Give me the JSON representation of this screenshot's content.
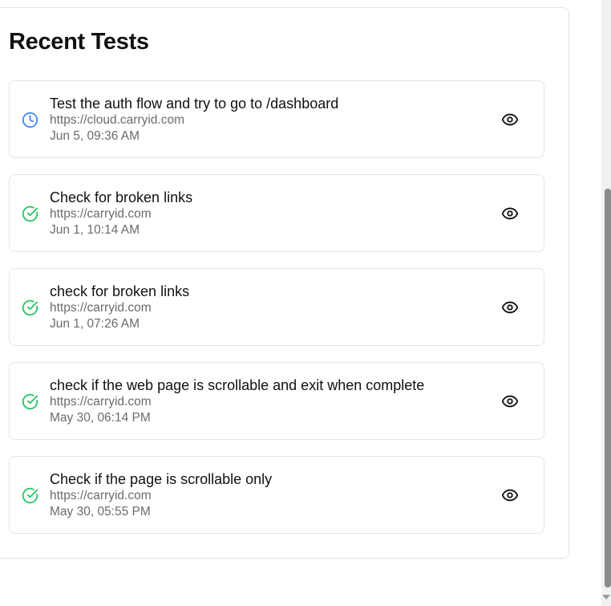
{
  "title": "Recent Tests",
  "colors": {
    "pending": "#3b82f6",
    "success": "#22c55e"
  },
  "tests": [
    {
      "name": "Test the auth flow and try to go to /dashboard",
      "url": "https://cloud.carryid.com",
      "date": "Jun 5, 09:36 AM",
      "status": "pending",
      "status_icon": "clock-icon",
      "action_icon": "eye-icon"
    },
    {
      "name": "Check for broken links",
      "url": "https://carryid.com",
      "date": "Jun 1, 10:14 AM",
      "status": "success",
      "status_icon": "check-circle-icon",
      "action_icon": "eye-icon"
    },
    {
      "name": "check for broken links",
      "url": "https://carryid.com",
      "date": "Jun 1, 07:26 AM",
      "status": "success",
      "status_icon": "check-circle-icon",
      "action_icon": "eye-icon"
    },
    {
      "name": "check if the web page is scrollable and exit when complete",
      "url": "https://carryid.com",
      "date": "May 30, 06:14 PM",
      "status": "success",
      "status_icon": "check-circle-icon",
      "action_icon": "eye-icon"
    },
    {
      "name": "Check if the page is scrollable only",
      "url": "https://carryid.com",
      "date": "May 30, 05:55 PM",
      "status": "success",
      "status_icon": "check-circle-icon",
      "action_icon": "eye-icon"
    }
  ]
}
